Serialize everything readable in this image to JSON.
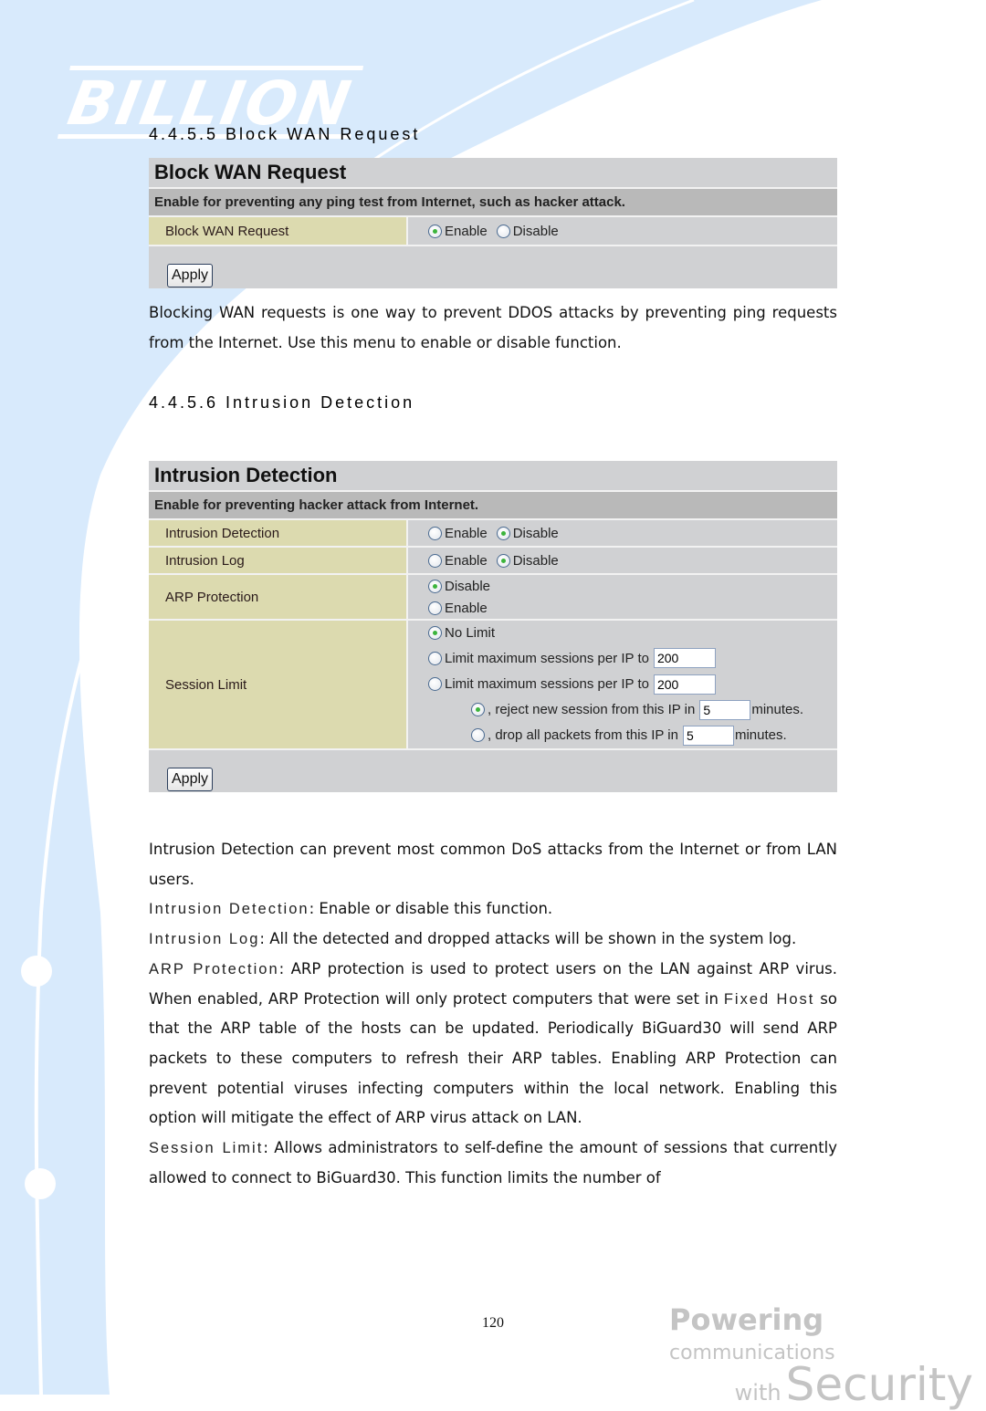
{
  "brand": {
    "logo_text": "BILLION",
    "slogan_line1_bold": "Powering",
    "slogan_line1_rest": "communications",
    "slogan_line2_small": "with",
    "slogan_line2_big": "Security"
  },
  "colors": {
    "background_deco": "#d8eafc",
    "panel_gray": "#d0d1d3",
    "panel_sub_gray": "#b9b9b9",
    "label_cell": "#dcdaaf",
    "radio_dot": "#3cb43c"
  },
  "section_block": {
    "heading": "4.4.5.5  Block WAN Request",
    "panel": {
      "title": "Block WAN Request",
      "subtitle": "Enable for preventing any ping test from Internet, such as hacker attack.",
      "rows": [
        {
          "label": "Block WAN Request",
          "options": [
            {
              "label": "Enable",
              "checked": true
            },
            {
              "label": "Disable",
              "checked": false
            }
          ]
        }
      ],
      "apply_label": "Apply"
    },
    "description": "Blocking WAN requests is one way to prevent DDOS attacks by preventing ping requests from the Internet. Use this menu to enable or disable function."
  },
  "section_intrusion": {
    "heading": "4.4.5.6  Intrusion Detection",
    "panel": {
      "title": "Intrusion Detection",
      "subtitle": "Enable for preventing hacker attack from Internet.",
      "intrusion_detection": {
        "label": "Intrusion Detection",
        "options": [
          {
            "label": "Enable",
            "checked": false
          },
          {
            "label": "Disable",
            "checked": true
          }
        ]
      },
      "intrusion_log": {
        "label": "Intrusion Log",
        "options": [
          {
            "label": "Enable",
            "checked": false
          },
          {
            "label": "Disable",
            "checked": true
          }
        ]
      },
      "arp_protection": {
        "label": "ARP Protection",
        "options": [
          {
            "label": "Disable",
            "checked": true
          },
          {
            "label": "Enable",
            "checked": false
          }
        ]
      },
      "session_limit": {
        "label": "Session Limit",
        "no_limit": {
          "label": "No Limit",
          "checked": true
        },
        "limit_1": {
          "label": "Limit maximum sessions per IP to",
          "checked": false,
          "value": "200"
        },
        "limit_2": {
          "label": "Limit maximum sessions per IP to",
          "checked": false,
          "value": "200"
        },
        "reject": {
          "label": ", reject new session from this IP in",
          "checked": true,
          "value": "5",
          "unit": "minutes."
        },
        "drop": {
          "label": ", drop all packets from this IP in",
          "checked": false,
          "value": "5",
          "unit": "minutes."
        }
      },
      "apply_label": "Apply"
    },
    "intro": "Intrusion Detection can prevent most common DoS attacks from the Internet or from LAN users.",
    "definitions": [
      {
        "term": "Intrusion Detection",
        "text": ": Enable or disable this function."
      },
      {
        "term": "Intrusion Log",
        "text": ": All the detected and dropped attacks will be shown in the system log."
      },
      {
        "term": "ARP Protection",
        "text": ": ARP protection is used to protect users on the LAN against ARP virus. When enabled, ARP Protection will only protect computers that were set in "
      },
      {
        "term": "Session Limit",
        "text": ": Allows administrators to self-define the amount of sessions that currently allowed to connect to BiGuard30. This function limits the number of"
      }
    ],
    "arp_inline_term": "Fixed Host",
    "arp_continuation": " so that the ARP table of the hosts can be updated. Periodically BiGuard30 will send ARP packets to these computers to refresh their ARP tables. Enabling ARP Protection can prevent potential viruses infecting computers within the local network. Enabling this option will mitigate the effect of ARP virus attack on LAN."
  },
  "footer": {
    "page_number": "120"
  }
}
